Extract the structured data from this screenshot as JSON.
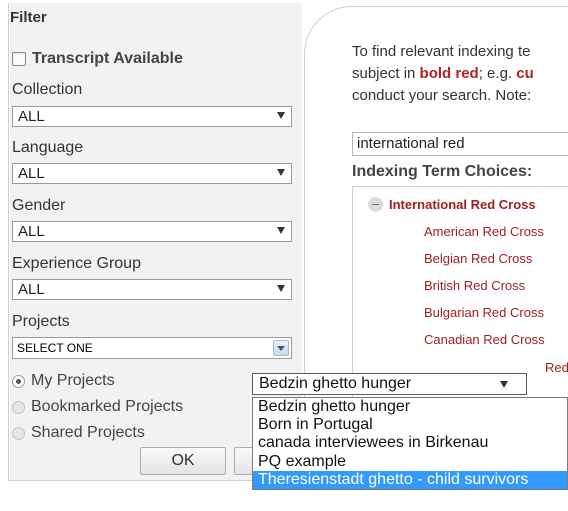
{
  "filter": {
    "title": "Filter",
    "transcript_label": "Transcript Available",
    "collection": {
      "label": "Collection",
      "value": "ALL"
    },
    "language": {
      "label": "Language",
      "value": "ALL"
    },
    "gender": {
      "label": "Gender",
      "value": "ALL"
    },
    "experience": {
      "label": "Experience Group",
      "value": "ALL"
    },
    "projects": {
      "label": "Projects",
      "value": "SELECT ONE"
    },
    "radios": [
      "My Projects",
      "Bookmarked Projects",
      "Shared Projects"
    ],
    "ok_label": "OK"
  },
  "content": {
    "intro_line1": "To find relevant indexing te",
    "intro_line2_a": "subject in ",
    "intro_line2_b": "bold red",
    "intro_line2_c": "; e.g. ",
    "intro_line2_d": "cu",
    "intro_line3": "conduct your search. Note:",
    "search_value": "international red",
    "choices_title": "Indexing Term Choices:",
    "tree_root": "International Red Cross",
    "tree_items": [
      "American Red Cross",
      "Belgian Red Cross",
      "British Red Cross",
      "Bulgarian Red Cross",
      "Canadian Red Cross"
    ],
    "partial_item": "Red"
  },
  "dropdown": {
    "selected": "Bedzin ghetto hunger",
    "options": [
      "Bedzin ghetto hunger",
      "Born in Portugal",
      "canada interviewees in Birkenau",
      "PQ example",
      "Theresienstadt ghetto - child survivors"
    ],
    "highlighted_index": 4
  },
  "colors": {
    "accent_red": "#a02020",
    "highlight_blue": "#3399ff",
    "panel_bg": "#f2f2f2"
  }
}
